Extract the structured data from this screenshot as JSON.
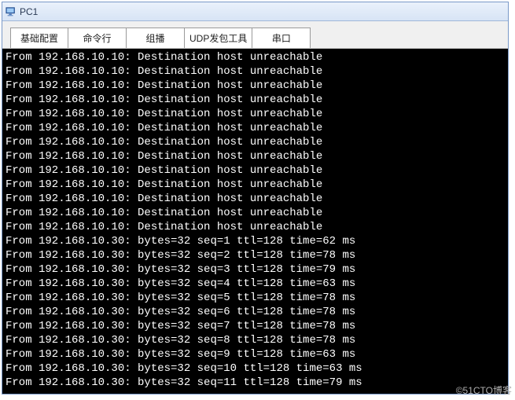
{
  "window": {
    "title": "PC1"
  },
  "tabs": [
    {
      "label": "基础配置"
    },
    {
      "label": "命令行"
    },
    {
      "label": "组播"
    },
    {
      "label": "UDP发包工具"
    },
    {
      "label": "串口"
    }
  ],
  "terminal": {
    "lines": [
      "From 192.168.10.10: Destination host unreachable",
      "From 192.168.10.10: Destination host unreachable",
      "From 192.168.10.10: Destination host unreachable",
      "From 192.168.10.10: Destination host unreachable",
      "From 192.168.10.10: Destination host unreachable",
      "From 192.168.10.10: Destination host unreachable",
      "From 192.168.10.10: Destination host unreachable",
      "From 192.168.10.10: Destination host unreachable",
      "From 192.168.10.10: Destination host unreachable",
      "From 192.168.10.10: Destination host unreachable",
      "From 192.168.10.10: Destination host unreachable",
      "From 192.168.10.10: Destination host unreachable",
      "From 192.168.10.10: Destination host unreachable",
      "From 192.168.10.30: bytes=32 seq=1 ttl=128 time=62 ms",
      "From 192.168.10.30: bytes=32 seq=2 ttl=128 time=78 ms",
      "From 192.168.10.30: bytes=32 seq=3 ttl=128 time=79 ms",
      "From 192.168.10.30: bytes=32 seq=4 ttl=128 time=63 ms",
      "From 192.168.10.30: bytes=32 seq=5 ttl=128 time=78 ms",
      "From 192.168.10.30: bytes=32 seq=6 ttl=128 time=78 ms",
      "From 192.168.10.30: bytes=32 seq=7 ttl=128 time=78 ms",
      "From 192.168.10.30: bytes=32 seq=8 ttl=128 time=78 ms",
      "From 192.168.10.30: bytes=32 seq=9 ttl=128 time=63 ms",
      "From 192.168.10.30: bytes=32 seq=10 ttl=128 time=63 ms",
      "From 192.168.10.30: bytes=32 seq=11 ttl=128 time=79 ms"
    ]
  },
  "watermark": "©51CTO博客"
}
